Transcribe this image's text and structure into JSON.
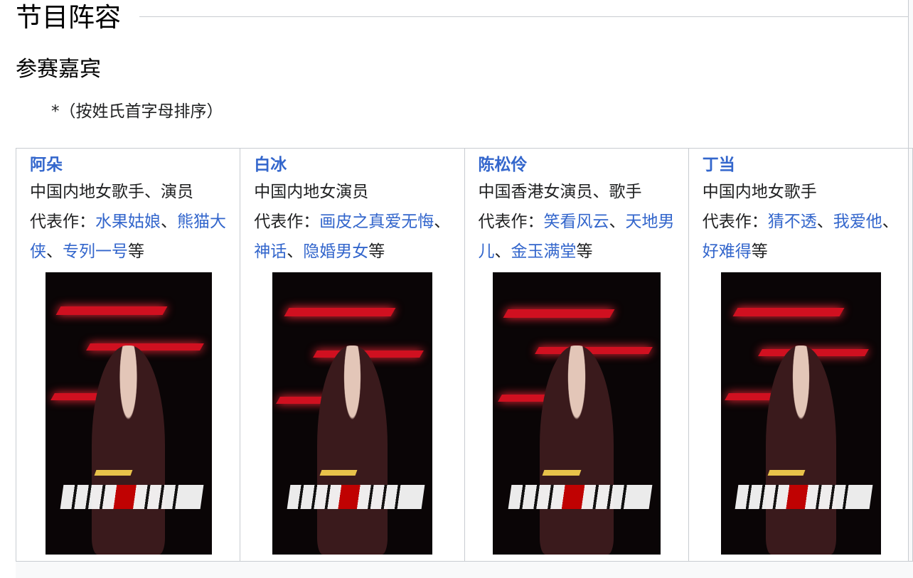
{
  "section": {
    "title": "节目阵容",
    "subtitle": "参赛嘉宾",
    "note": "*（按姓氏首字母排序）"
  },
  "cast": [
    {
      "name": "阿朵",
      "desc": "中国内地女歌手、演员",
      "works_prefix": "代表作：",
      "works": [
        "水果姑娘",
        "熊猫大侠",
        "专列一号"
      ],
      "works_suffix": "等",
      "poster_icon": "portrait-poster"
    },
    {
      "name": "白冰",
      "desc": "中国内地女演员",
      "works_prefix": "代表作：",
      "works": [
        "画皮之真爱无悔",
        "神话",
        "隐婚男女"
      ],
      "works_suffix": "等",
      "poster_icon": "portrait-poster"
    },
    {
      "name": "陈松伶",
      "desc": "中国香港女演员、歌手",
      "works_prefix": "代表作：",
      "works": [
        "笑看风云",
        "天地男儿",
        "金玉满堂"
      ],
      "works_suffix": "等",
      "poster_icon": "portrait-poster"
    },
    {
      "name": "丁当",
      "desc": "中国内地女歌手",
      "works_prefix": "代表作：",
      "works": [
        "猜不透",
        "我爱他",
        "好难得"
      ],
      "works_suffix": "等",
      "poster_icon": "portrait-poster"
    }
  ],
  "colors": {
    "link": "#3366cc",
    "border": "#c8ccd1",
    "poster_accent": "#d01020"
  }
}
